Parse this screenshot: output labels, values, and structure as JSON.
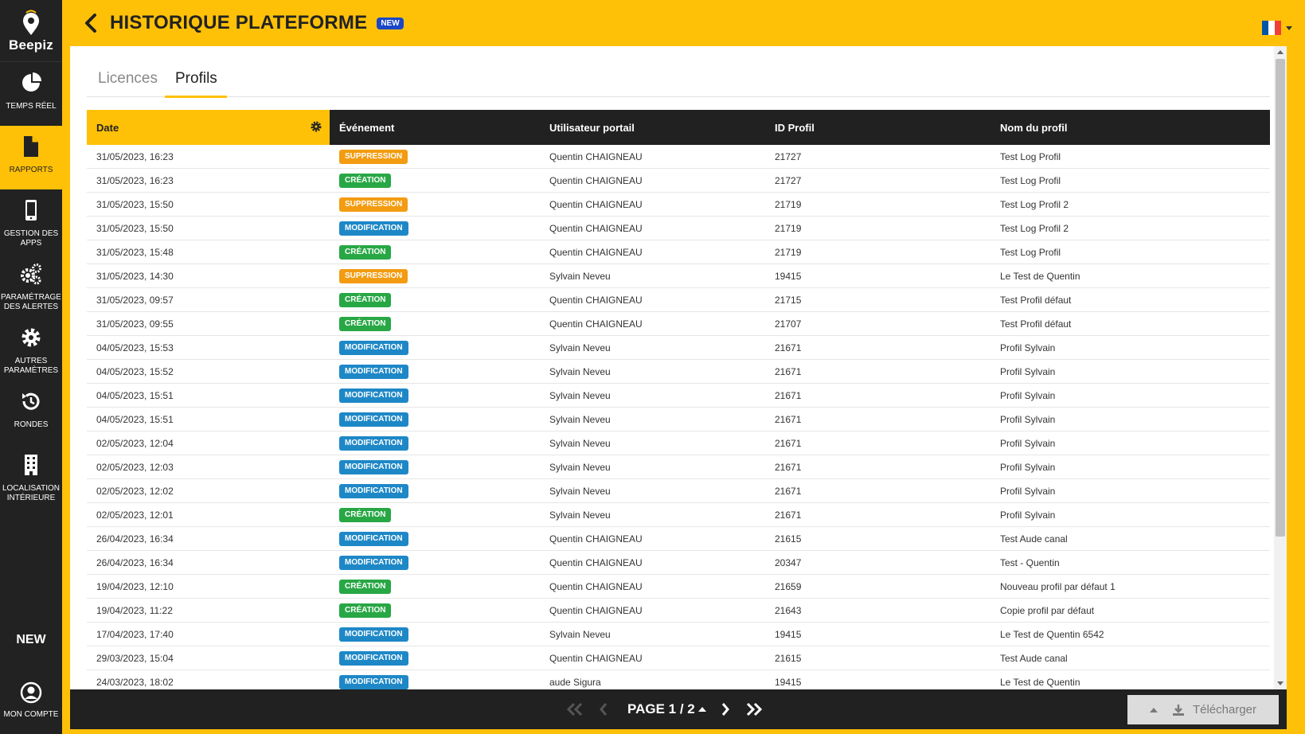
{
  "app": {
    "brand": "Beepiz"
  },
  "header": {
    "title": "HISTORIQUE PLATEFORME",
    "new_badge": "NEW",
    "flag_colors": [
      "#0055a4",
      "#ffffff",
      "#ef4135"
    ]
  },
  "sidebar": {
    "items": [
      {
        "label": "TEMPS RÉEL",
        "icon": "pie-chart-icon"
      },
      {
        "label": "RAPPORTS",
        "icon": "document-icon"
      },
      {
        "label": "GESTION DES APPS",
        "icon": "smartphone-icon"
      },
      {
        "label": "PARAMÉTRAGE DES ALERTES",
        "icon": "gears-icon"
      },
      {
        "label": "AUTRES PARAMÈTRES",
        "icon": "gear-icon"
      },
      {
        "label": "RONDES",
        "icon": "history-icon"
      },
      {
        "label": "LOCALISATION INTÉRIEURE",
        "icon": "building-icon"
      }
    ],
    "new_label": "NEW",
    "account_label": "MON COMPTE"
  },
  "tabs": [
    {
      "label": "Licences"
    },
    {
      "label": "Profils"
    }
  ],
  "table": {
    "columns": [
      "Date",
      "Événement",
      "Utilisateur portail",
      "ID Profil",
      "Nom du profil"
    ],
    "rows": [
      [
        "31/05/2023, 16:23",
        "SUPPRESSION",
        "Quentin CHAIGNEAU",
        "21727",
        "Test Log Profil"
      ],
      [
        "31/05/2023, 16:23",
        "CRÉATION",
        "Quentin CHAIGNEAU",
        "21727",
        "Test Log Profil"
      ],
      [
        "31/05/2023, 15:50",
        "SUPPRESSION",
        "Quentin CHAIGNEAU",
        "21719",
        "Test Log Profil 2"
      ],
      [
        "31/05/2023, 15:50",
        "MODIFICATION",
        "Quentin CHAIGNEAU",
        "21719",
        "Test Log Profil 2"
      ],
      [
        "31/05/2023, 15:48",
        "CRÉATION",
        "Quentin CHAIGNEAU",
        "21719",
        "Test Log Profil"
      ],
      [
        "31/05/2023, 14:30",
        "SUPPRESSION",
        "Sylvain Neveu",
        "19415",
        "Le Test de Quentin"
      ],
      [
        "31/05/2023, 09:57",
        "CRÉATION",
        "Quentin CHAIGNEAU",
        "21715",
        "Test Profil défaut"
      ],
      [
        "31/05/2023, 09:55",
        "CRÉATION",
        "Quentin CHAIGNEAU",
        "21707",
        "Test Profil défaut"
      ],
      [
        "04/05/2023, 15:53",
        "MODIFICATION",
        "Sylvain Neveu",
        "21671",
        "Profil Sylvain"
      ],
      [
        "04/05/2023, 15:52",
        "MODIFICATION",
        "Sylvain Neveu",
        "21671",
        "Profil Sylvain"
      ],
      [
        "04/05/2023, 15:51",
        "MODIFICATION",
        "Sylvain Neveu",
        "21671",
        "Profil Sylvain"
      ],
      [
        "04/05/2023, 15:51",
        "MODIFICATION",
        "Sylvain Neveu",
        "21671",
        "Profil Sylvain"
      ],
      [
        "02/05/2023, 12:04",
        "MODIFICATION",
        "Sylvain Neveu",
        "21671",
        "Profil Sylvain"
      ],
      [
        "02/05/2023, 12:03",
        "MODIFICATION",
        "Sylvain Neveu",
        "21671",
        "Profil Sylvain"
      ],
      [
        "02/05/2023, 12:02",
        "MODIFICATION",
        "Sylvain Neveu",
        "21671",
        "Profil Sylvain"
      ],
      [
        "02/05/2023, 12:01",
        "CRÉATION",
        "Sylvain Neveu",
        "21671",
        "Profil Sylvain"
      ],
      [
        "26/04/2023, 16:34",
        "MODIFICATION",
        "Quentin CHAIGNEAU",
        "21615",
        "Test Aude canal"
      ],
      [
        "26/04/2023, 16:34",
        "MODIFICATION",
        "Quentin CHAIGNEAU",
        "20347",
        "Test - Quentin"
      ],
      [
        "19/04/2023, 12:10",
        "CRÉATION",
        "Quentin CHAIGNEAU",
        "21659",
        "Nouveau profil par défaut 1"
      ],
      [
        "19/04/2023, 11:22",
        "CRÉATION",
        "Quentin CHAIGNEAU",
        "21643",
        "Copie profil par défaut"
      ],
      [
        "17/04/2023, 17:40",
        "MODIFICATION",
        "Sylvain Neveu",
        "19415",
        "Le Test de Quentin 6542"
      ],
      [
        "29/03/2023, 15:04",
        "MODIFICATION",
        "Quentin CHAIGNEAU",
        "21615",
        "Test Aude canal"
      ],
      [
        "24/03/2023, 18:02",
        "MODIFICATION",
        "aude Sigura",
        "19415",
        "Le Test de Quentin"
      ]
    ]
  },
  "pagination": {
    "label": "PAGE 1 / 2"
  },
  "download": {
    "label": "Télécharger"
  }
}
